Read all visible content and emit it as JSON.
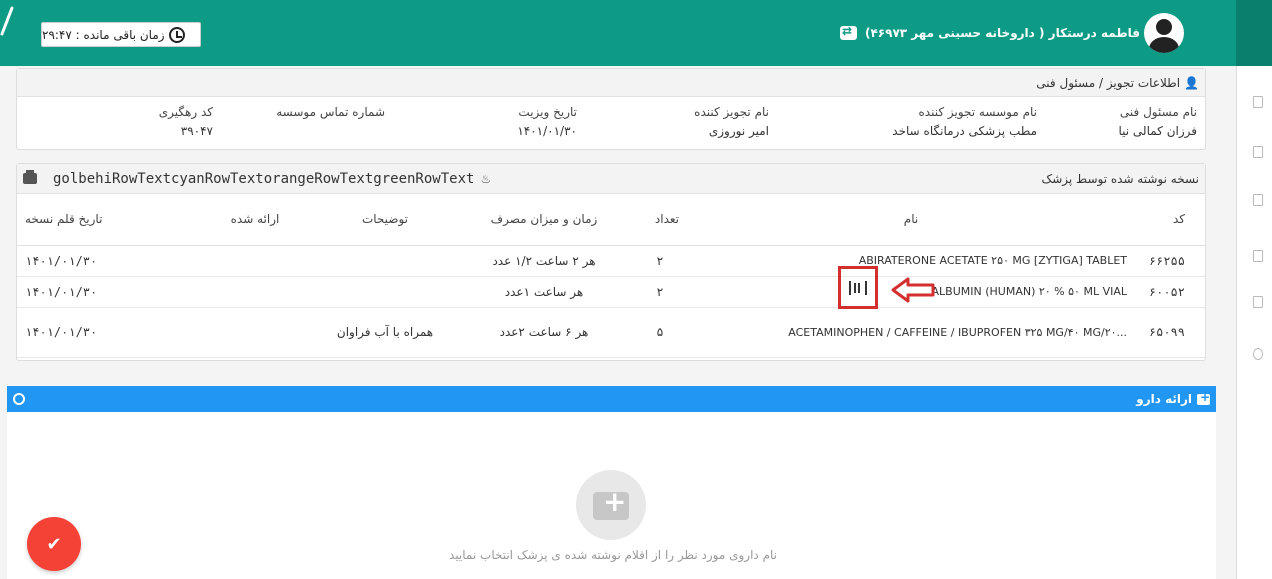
{
  "header": {
    "timer_label": "زمان باقی مانده : ۲۹:۴۷",
    "user_name": "فاطمه درستکار ( داروخانه حسینی مهر ۴۶۹۷۳)"
  },
  "prescriber_info": {
    "title": "اطلاعات تجویز / مسئول فنی",
    "fields": [
      {
        "label": "نام مسئول فنی",
        "value": "فرزان کمالی نیا"
      },
      {
        "label": "نام موسسه تجویز کننده",
        "value": "مطب پزشکی درمانگاه ساخد"
      },
      {
        "label": "نام تجویز کننده",
        "value": "امیر نوروزی"
      },
      {
        "label": "تاریخ ویزیت",
        "value": "۱۴۰۱/۰۱/۳۰"
      },
      {
        "label": "شماره تماس موسسه",
        "value": ""
      },
      {
        "label": "کد رهگیری",
        "value": "۳۹۰۴۷"
      }
    ]
  },
  "prescription": {
    "title": "نسخه نوشته شده توسط پزشک",
    "code": "golbehiRowTextcyanRowTextorangeRowTextgreenRowText",
    "columns": [
      "کد",
      "نام",
      "تعداد",
      "زمان و میزان مصرف",
      "توضیحات",
      "ارائه شده",
      "تاریخ قلم نسخه"
    ],
    "rows": [
      {
        "code": "۶۶۲۵۵",
        "name": "ABIRATERONE ACETATE ۲۵۰ MG [ZYTIGA] TABLET",
        "qty": "۲",
        "usage": "هر ۲ ساعت ۱/۲ عدد",
        "notes": "",
        "given": "",
        "date": "۱۴۰۱/۰۱/۳۰"
      },
      {
        "code": "۶۰۰۵۲",
        "name": "ALBUMIN (HUMAN) ۲۰ % ۵۰ ML VIAL",
        "qty": "۲",
        "usage": "هر ساعت ۱عدد",
        "notes": "",
        "given": "",
        "date": "۱۴۰۱/۰۱/۳۰"
      },
      {
        "code": "۶۵۰۹۹",
        "name": "ACETAMINOPHEN / CAFFEINE / IBUPROFEN ۳۲۵ MG/۴۰ MG/۲۰...",
        "qty": "۵",
        "usage": "هر ۶ ساعت ۲عدد",
        "notes": "همراه با آب فراوان",
        "given": "",
        "date": "۱۴۰۱/۰۱/۳۰"
      }
    ]
  },
  "dispense": {
    "title": "ارائه دارو",
    "empty_text": "نام داروی مورد نظر را از اقلام نوشته شده ی پزشک انتخاب نمایید"
  },
  "colors": {
    "topbar": "#0d9b86",
    "blue_bar": "#2196f3",
    "fab": "#f44336",
    "highlight": "#d32f2f"
  }
}
